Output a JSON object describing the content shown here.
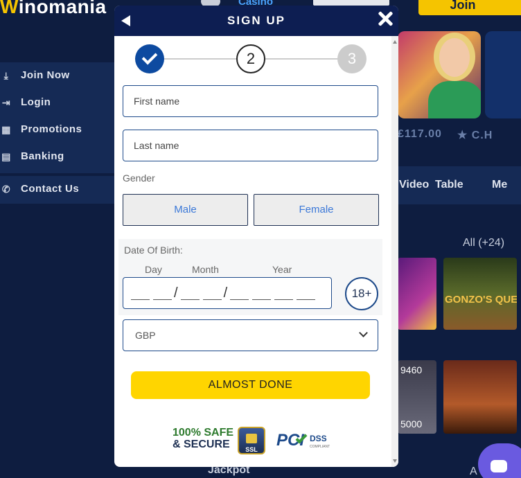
{
  "site": {
    "logo": "Winomania",
    "logo_first_letter": "W",
    "logo_rest": "inomania",
    "top_tab": "Casino",
    "join_label": "Join",
    "sidebar": [
      {
        "label": "Join Now",
        "icon": "download-icon"
      },
      {
        "label": "Login",
        "icon": "login-icon"
      },
      {
        "label": "Promotions",
        "icon": "gift-icon"
      },
      {
        "label": "Banking",
        "icon": "banking-icon"
      },
      {
        "label": "Contact Us",
        "icon": "phone-icon"
      }
    ],
    "winner_amount": "£117.00",
    "winner_name": "C.H",
    "categories": [
      "Video",
      "Table",
      "Me"
    ],
    "all_count": "All (+24)",
    "game_title": "GONZO'S QUEST",
    "jackpot_value": "9460",
    "jackpot_value2": "5000",
    "jackpot_heading": "Jackpot",
    "a_label": "A"
  },
  "modal": {
    "title": "SIGN UP",
    "steps": [
      {
        "number": "1",
        "state": "completed"
      },
      {
        "number": "2",
        "state": "current"
      },
      {
        "number": "3",
        "state": "upcoming"
      }
    ],
    "first_name_placeholder": "First name",
    "last_name_placeholder": "Last name",
    "gender_label": "Gender",
    "gender_male": "Male",
    "gender_female": "Female",
    "dob_label": "Date Of Birth:",
    "dob_day": "Day",
    "dob_month": "Month",
    "dob_year": "Year",
    "age_badge": "18+",
    "currency_value": "GBP",
    "cta_label": "ALMOST DONE",
    "trust_safe_line1": "100% SAFE",
    "trust_safe_line2": "& SECURE",
    "ssl_label": "SSL",
    "pci_label": "PCI",
    "dss_label": "DSS",
    "pci_compliant": "COMPLIANT"
  },
  "colors": {
    "page_bg": "#0e1d40",
    "modal_header": "#0d1e52",
    "accent_yellow": "#ffd500",
    "step_done": "#0d4aa0",
    "gender_text": "#3b78d8"
  }
}
